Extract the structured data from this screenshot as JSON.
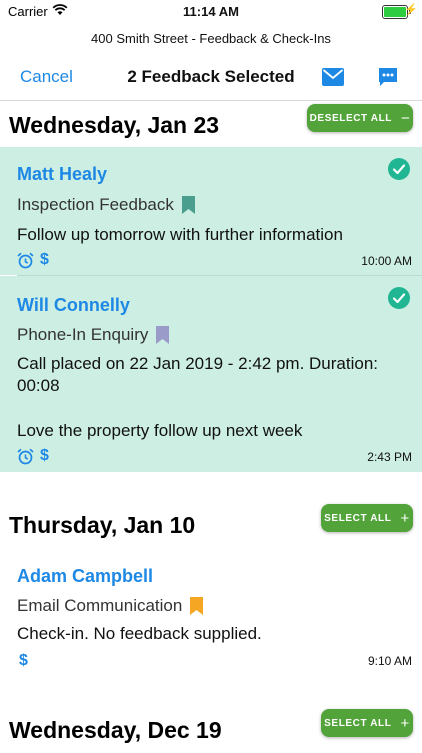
{
  "status_bar": {
    "carrier": "Carrier",
    "time": "11:14 AM"
  },
  "header": {
    "subtitle": "400 Smith Street - Feedback & Check-Ins"
  },
  "nav": {
    "cancel": "Cancel",
    "title": "2 Feedback Selected"
  },
  "sections": [
    {
      "date": "Wednesday, Jan 23",
      "button": "DESELECT ALL",
      "button_symbol": "−"
    },
    {
      "date": "Thursday, Jan 10",
      "button": "SELECT ALL",
      "button_symbol": "+"
    },
    {
      "date": "Wednesday, Dec 19",
      "button": "SELECT ALL",
      "button_symbol": "+"
    }
  ],
  "items": [
    {
      "name": "Matt Healy",
      "type": "Inspection Feedback",
      "text": "Follow up tomorrow with further information",
      "time": "10:00 AM",
      "selected": true,
      "bookmark_color": "#4a9e8e"
    },
    {
      "name": "Will Connelly",
      "type": "Phone-In Enquiry",
      "text1": "Call placed on 22 Jan 2019 - 2:42 pm. Duration: 00:08",
      "text2": "Love the property follow up next week",
      "time": "2:43 PM",
      "selected": true,
      "bookmark_color": "#9b9bc9"
    },
    {
      "name": "Adam Campbell",
      "type": "Email Communication",
      "text": "Check-in. No feedback supplied.",
      "time": "9:10 AM",
      "selected": false,
      "bookmark_color": "#f5a623"
    }
  ],
  "icons": {
    "dollar": "$"
  },
  "colors": {
    "accent": "#1e88e5",
    "selected_bg": "#cdeee3",
    "button_green": "#52a33a",
    "check_teal": "#20b593"
  }
}
